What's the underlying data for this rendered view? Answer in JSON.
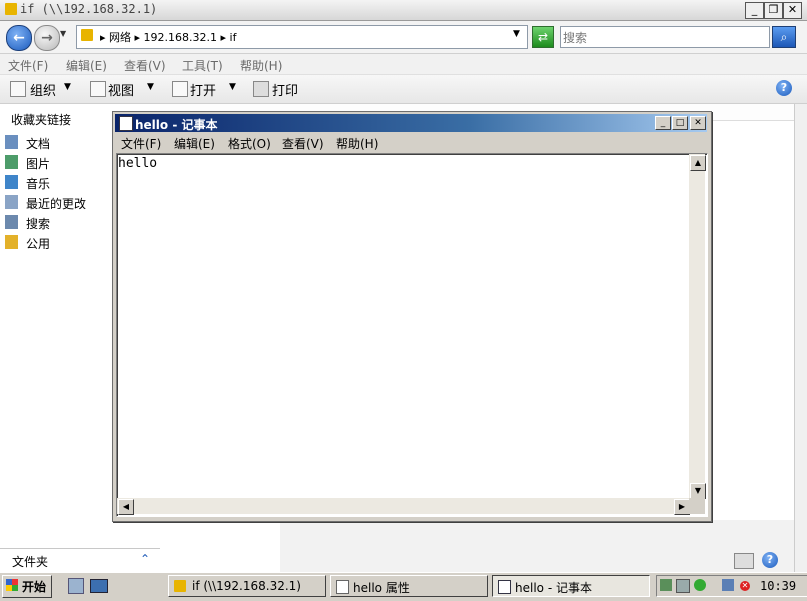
{
  "explorer": {
    "title": "if (\\\\192.168.32.1)",
    "nav": {
      "back_icon": "back-arrow-icon",
      "forward_icon": "forward-arrow-icon"
    },
    "address": "▸ 网络 ▸ 192.168.32.1 ▸ if",
    "search_placeholder": "搜索",
    "menu": [
      "文件(F)",
      "编辑(E)",
      "查看(V)",
      "工具(T)",
      "帮助(H)"
    ],
    "toolbar": {
      "organize": "组织",
      "views": "视图",
      "open": "打开",
      "print": "打印"
    },
    "sidebar": {
      "favorites_title": "收藏夹链接",
      "items": [
        "文档",
        "图片",
        "音乐",
        "最近的更改",
        "搜索",
        "公用"
      ],
      "folders_label": "文件夹"
    }
  },
  "notepad": {
    "title": "hello - 记事本",
    "menu": [
      "文件(F)",
      "编辑(E)",
      "格式(O)",
      "查看(V)",
      "帮助(H)"
    ],
    "content": "hello"
  },
  "taskbar": {
    "start_label": "开始",
    "buttons": [
      "if (\\\\192.168.32.1)",
      "hello 属性",
      "hello - 记事本"
    ],
    "clock": "10:39"
  },
  "colors": {
    "notepad_title_start": "#0a246a",
    "notepad_title_end": "#a6caf0",
    "taskbar": "#d4d0c8"
  }
}
